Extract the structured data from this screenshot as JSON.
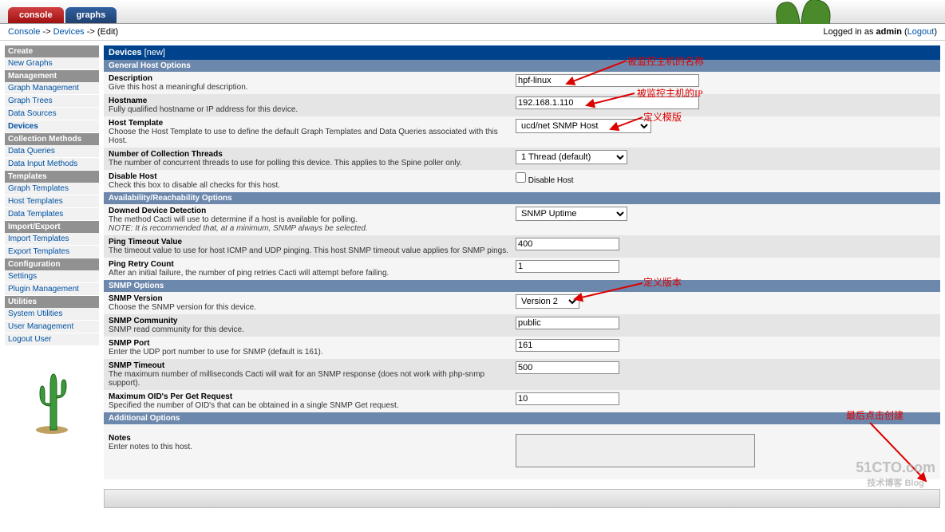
{
  "tabs": {
    "console": "console",
    "graphs": "graphs"
  },
  "breadcrumb": {
    "a": "Console",
    "b": "Devices",
    "c": "(Edit)"
  },
  "login": {
    "prefix": "Logged in as ",
    "user": "admin",
    "logout": "Logout"
  },
  "sidebar": {
    "create": "Create",
    "new_graphs": "New Graphs",
    "management": "Management",
    "graph_mgmt": "Graph Management",
    "graph_trees": "Graph Trees",
    "data_sources": "Data Sources",
    "devices": "Devices",
    "collection": "Collection Methods",
    "data_queries": "Data Queries",
    "data_input": "Data Input Methods",
    "templates": "Templates",
    "graph_templates": "Graph Templates",
    "host_templates": "Host Templates",
    "data_templates": "Data Templates",
    "import_export": "Import/Export",
    "import_templates": "Import Templates",
    "export_templates": "Export Templates",
    "configuration": "Configuration",
    "settings": "Settings",
    "plugin_mgmt": "Plugin Management",
    "utilities": "Utilities",
    "sys_util": "System Utilities",
    "user_mgmt": "User Management",
    "logout": "Logout User"
  },
  "panel": {
    "title": "Devices",
    "title_sub": "[new]",
    "sec_general": "General Host Options",
    "desc_lbl": "Description",
    "desc_txt": "Give this host a meaningful description.",
    "desc_val": "hpf-linux",
    "host_lbl": "Hostname",
    "host_txt": "Fully qualified hostname or IP address for this device.",
    "host_val": "192.168.1.110",
    "tmpl_lbl": "Host Template",
    "tmpl_txt": "Choose the Host Template to use to define the default Graph Templates and Data Queries associated with this Host.",
    "tmpl_val": "ucd/net SNMP Host",
    "threads_lbl": "Number of Collection Threads",
    "threads_txt": "The number of concurrent threads to use for polling this device. This applies to the Spine poller only.",
    "threads_val": "1 Thread (default)",
    "disable_lbl": "Disable Host",
    "disable_txt": "Check this box to disable all checks for this host.",
    "disable_chk": "Disable Host",
    "sec_avail": "Availability/Reachability Options",
    "downed_lbl": "Downed Device Detection",
    "downed_txt": "The method Cacti will use to determine if a host is available for polling.",
    "downed_note": "NOTE: It is recommended that, at a minimum, SNMP always be selected.",
    "downed_val": "SNMP Uptime",
    "timeout_lbl": "Ping Timeout Value",
    "timeout_txt": "The timeout value to use for host ICMP and UDP pinging. This host SNMP timeout value applies for SNMP pings.",
    "timeout_val": "400",
    "retry_lbl": "Ping Retry Count",
    "retry_txt": "After an initial failure, the number of ping retries Cacti will attempt before failing.",
    "retry_val": "1",
    "sec_snmp": "SNMP Options",
    "snmpv_lbl": "SNMP Version",
    "snmpv_txt": "Choose the SNMP version for this device.",
    "snmpv_val": "Version 2",
    "snmpc_lbl": "SNMP Community",
    "snmpc_txt": "SNMP read community for this device.",
    "snmpc_val": "public",
    "snmpp_lbl": "SNMP Port",
    "snmpp_txt": "Enter the UDP port number to use for SNMP (default is 161).",
    "snmpp_val": "161",
    "snmpt_lbl": "SNMP Timeout",
    "snmpt_txt": "The maximum number of milliseconds Cacti will wait for an SNMP response (does not work with php-snmp support).",
    "snmpt_val": "500",
    "oid_lbl": "Maximum OID's Per Get Request",
    "oid_txt": "Specified the number of OID's that can be obtained in a single SNMP Get request.",
    "oid_val": "10",
    "sec_add": "Additional Options",
    "notes_lbl": "Notes",
    "notes_txt": "Enter notes to this host."
  },
  "annot": {
    "a1": "被监控主机的名称",
    "a2": "被监控主机的IP",
    "a3": "定义模版",
    "a4": "定义版本",
    "a5": "最后点击创建"
  },
  "watermark": {
    "main": "51CTO.com",
    "sub": "技术博客  Blog"
  }
}
